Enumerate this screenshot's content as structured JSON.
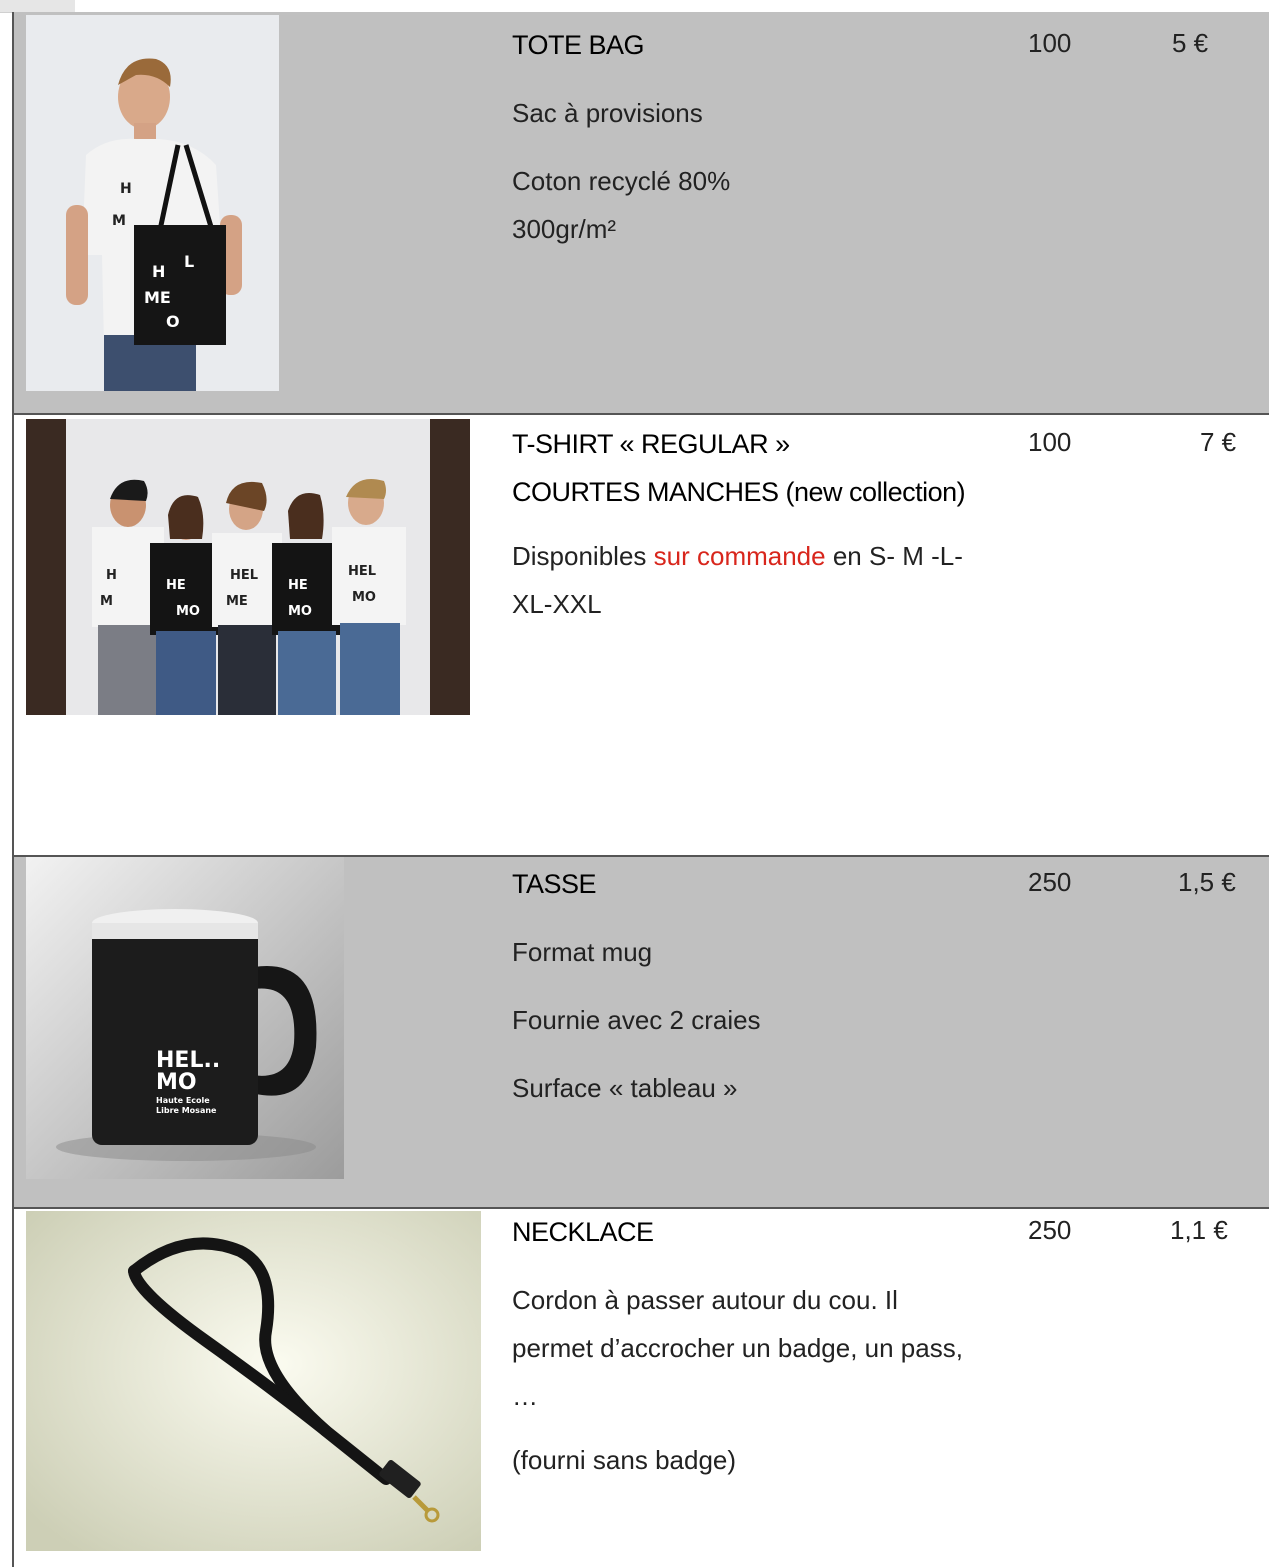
{
  "products": [
    {
      "title": "TOTE BAG",
      "quantity": "100",
      "price": "5 €",
      "desc_1": "Sac à provisions",
      "desc_2": "Coton recyclé 80%",
      "desc_3": "300gr/m²"
    },
    {
      "title_line1": "T-SHIRT « REGULAR »",
      "title_line2": "COURTES MANCHES (new collection)",
      "quantity": "100",
      "price": "7 €",
      "desc_pre": "Disponibles ",
      "desc_red": "sur commande",
      "desc_post": " en S- M -L-",
      "desc_line2": "XL-XXL"
    },
    {
      "title": "TASSE",
      "quantity": "250",
      "price": "1,5 €",
      "desc_1": "Format mug",
      "desc_2": "Fournie avec 2 craies",
      "desc_3": "Surface « tableau »",
      "mug_logo_1": "HEL..",
      "mug_logo_2": "MO",
      "mug_logo_3": "Haute Ecole",
      "mug_logo_4": "Libre Mosane"
    },
    {
      "title": "NECKLACE",
      "quantity": "250",
      "price": "1,1 €",
      "desc_1": "Cordon à passer autour du cou. Il",
      "desc_2": "permet d’accrocher un badge, un pass,",
      "desc_3": "…",
      "desc_4": "(fourni sans badge)"
    }
  ]
}
